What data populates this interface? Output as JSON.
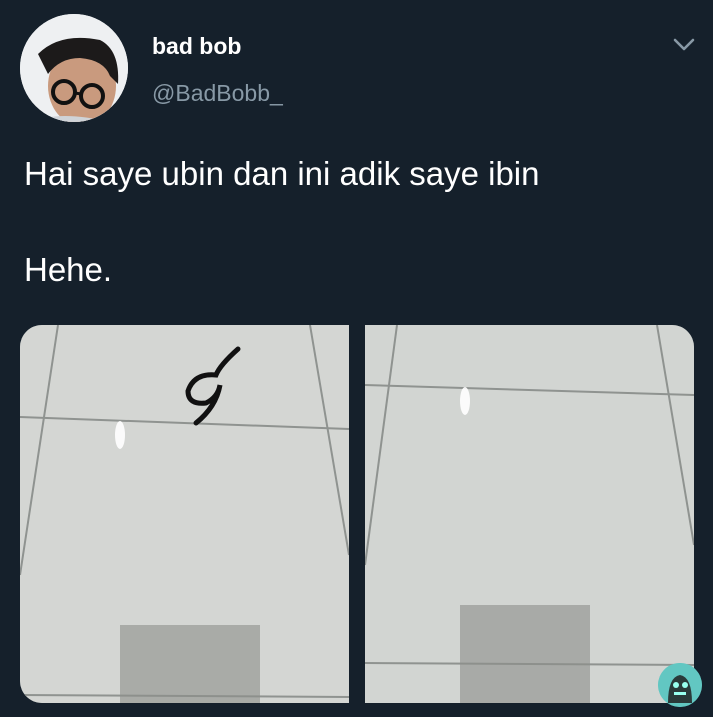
{
  "tweet": {
    "display_name": "bad bob",
    "handle": "@BadBobb_",
    "text_line1": "Hai saye ubin dan ini adik saye ibin",
    "text_line2": "Hehe."
  },
  "icons": {
    "menu": "chevron-down-icon",
    "badge": "app-logo-badge"
  },
  "colors": {
    "background": "#15202b",
    "text": "#ffffff",
    "secondary_text": "#8899a6"
  }
}
